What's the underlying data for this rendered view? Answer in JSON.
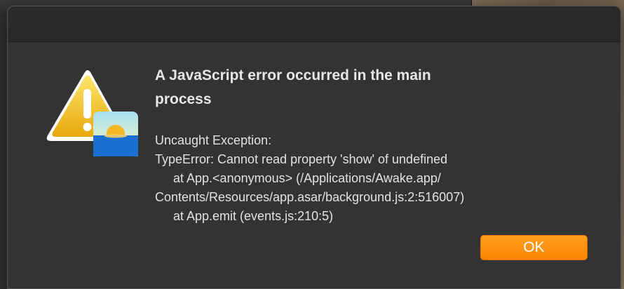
{
  "dialog": {
    "title": "A JavaScript error occurred in the main process",
    "message_lines": [
      "Uncaught Exception:",
      "TypeError: Cannot read property 'show' of undefined",
      "at App.<anonymous> (/Applications/Awake.app/",
      "Contents/Resources/app.asar/background.js:2:516007)",
      "at App.emit (events.js:210:5)"
    ],
    "ok_label": "OK"
  },
  "icons": {
    "alert": "warning-triangle-icon",
    "app_badge": "awake-app-icon"
  },
  "colors": {
    "dialog_bg": "#333333",
    "button_orange": "#fb8500",
    "warning_yellow": "#f6c21c"
  }
}
